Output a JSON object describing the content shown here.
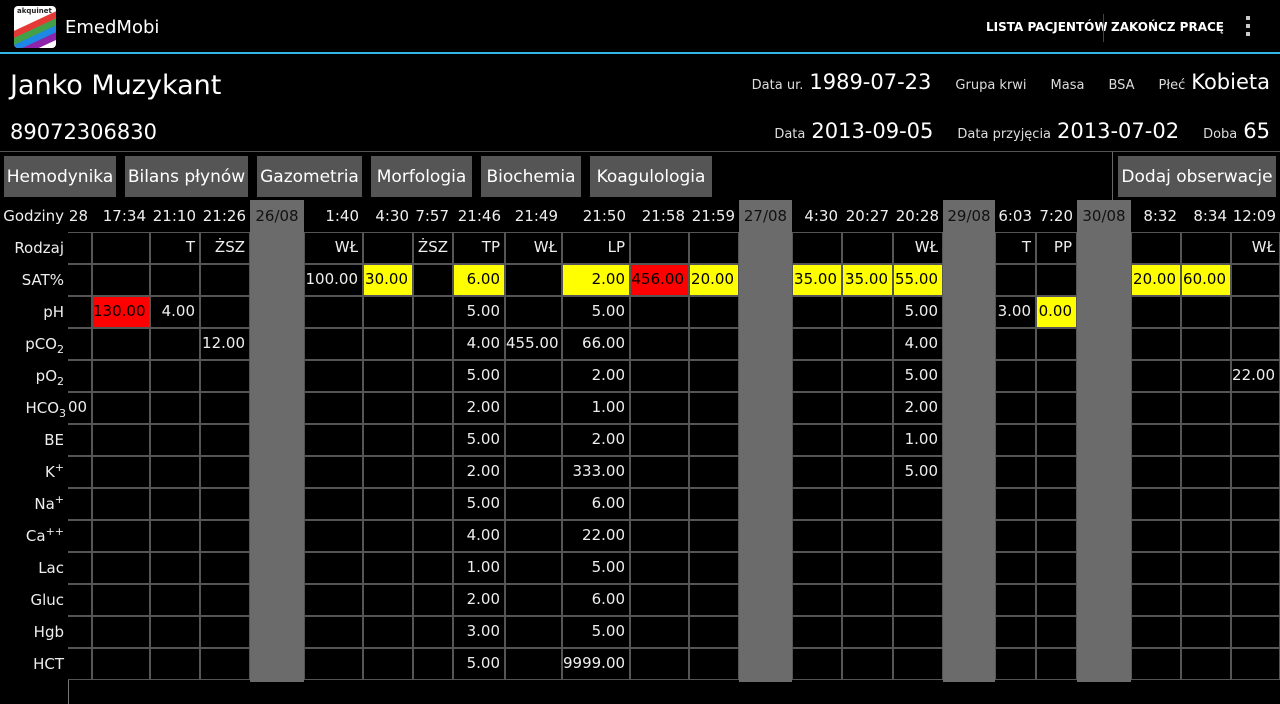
{
  "app": {
    "name": "EmedMobi",
    "logo_text": "akquinet"
  },
  "actions": {
    "patients": "LISTA PACJENTÓW",
    "finish": "ZAKOŃCZ PRACĘ"
  },
  "patient": {
    "name": "Janko Muzykant",
    "pesel": "89072306830",
    "dob_label": "Data ur.",
    "dob": "1989-07-23",
    "blood_label": "Grupa krwi",
    "mass_label": "Masa",
    "bsa_label": "BSA",
    "sex_label": "Płeć",
    "sex": "Kobieta",
    "date_label": "Data",
    "date": "2013-09-05",
    "admission_label": "Data przyjęcia",
    "admission": "2013-07-02",
    "day_label": "Doba",
    "day": "65"
  },
  "tabs": [
    "Hemodynika",
    "Bilans płynów",
    "Gazometria",
    "Morfologia",
    "Biochemia",
    "Koagulologia"
  ],
  "add_button": "Dodaj obserwacje",
  "row_labels": {
    "hours": "Godziny",
    "type": "Rodzaj",
    "sat": "SAT%",
    "ph": "pH",
    "pco2_base": "pCO",
    "pco2_sub": "2",
    "po2_base": "pO",
    "po2_sub": "2",
    "hco3_base": "HCO",
    "hco3_sub": "3",
    "be": "BE",
    "k_base": "K",
    "k_sup": "+",
    "na_base": "Na",
    "na_sup": "+",
    "ca_base": "Ca",
    "ca_sup": "++",
    "lac": "Lac",
    "gluc": "Gluc",
    "hgb": "Hgb",
    "hct": "HCT"
  },
  "table": {
    "columns": [
      {
        "kind": "data",
        "time": "28",
        "cells": [
          "",
          "",
          "",
          "",
          "",
          "00",
          "",
          "",
          "",
          "",
          "",
          "",
          "",
          ""
        ]
      },
      {
        "kind": "data",
        "time": "17:34",
        "cells": [
          "",
          "",
          "130.00",
          "",
          "",
          "",
          "",
          "",
          "",
          "",
          "",
          "",
          "",
          ""
        ]
      },
      {
        "kind": "data",
        "time": "21:10",
        "cells": [
          "T",
          "",
          "4.00",
          "",
          "",
          "",
          "",
          "",
          "",
          "",
          "",
          "",
          "",
          ""
        ]
      },
      {
        "kind": "data",
        "time": "21:26",
        "cells": [
          "ŻSZ",
          "",
          "",
          "12.00",
          "",
          "",
          "",
          "",
          "",
          "",
          "",
          "",
          "",
          ""
        ]
      },
      {
        "kind": "date",
        "label": "26/08"
      },
      {
        "kind": "data",
        "time": "1:40",
        "cells": [
          "WŁ",
          "100.00",
          "",
          "",
          "",
          "",
          "",
          "",
          "",
          "",
          "",
          "",
          "",
          ""
        ]
      },
      {
        "kind": "data",
        "time": "4:30",
        "cells": [
          "",
          "30.00",
          "",
          "",
          "",
          "",
          "",
          "",
          "",
          "",
          "",
          "",
          "",
          ""
        ]
      },
      {
        "kind": "data",
        "time": "7:57",
        "cells": [
          "ŻSZ",
          "",
          "",
          "",
          "",
          "",
          "",
          "",
          "",
          "",
          "",
          "",
          "",
          ""
        ]
      },
      {
        "kind": "data",
        "time": "21:46",
        "cells": [
          "TP",
          "6.00",
          "5.00",
          "4.00",
          "5.00",
          "2.00",
          "5.00",
          "2.00",
          "5.00",
          "4.00",
          "1.00",
          "2.00",
          "3.00",
          "5.00"
        ]
      },
      {
        "kind": "data",
        "time": "21:49",
        "cells": [
          "WŁ",
          "",
          "",
          "455.00",
          "",
          "",
          "",
          "",
          "",
          "",
          "",
          "",
          "",
          ""
        ]
      },
      {
        "kind": "data",
        "time": "21:50",
        "cells": [
          "LP",
          "2.00",
          "5.00",
          "66.00",
          "2.00",
          "1.00",
          "2.00",
          "333.00",
          "6.00",
          "22.00",
          "5.00",
          "6.00",
          "5.00",
          "9999.00"
        ]
      },
      {
        "kind": "data",
        "time": "21:58",
        "cells": [
          "",
          "456.00",
          "",
          "",
          "",
          "",
          "",
          "",
          "",
          "",
          "",
          "",
          "",
          ""
        ]
      },
      {
        "kind": "data",
        "time": "21:59",
        "cells": [
          "",
          "20.00",
          "",
          "",
          "",
          "",
          "",
          "",
          "",
          "",
          "",
          "",
          "",
          ""
        ]
      },
      {
        "kind": "date",
        "label": "27/08"
      },
      {
        "kind": "data",
        "time": "4:30",
        "cells": [
          "",
          "35.00",
          "",
          "",
          "",
          "",
          "",
          "",
          "",
          "",
          "",
          "",
          "",
          ""
        ]
      },
      {
        "kind": "data",
        "time": "20:27",
        "cells": [
          "",
          "35.00",
          "",
          "",
          "",
          "",
          "",
          "",
          "",
          "",
          "",
          "",
          "",
          ""
        ]
      },
      {
        "kind": "data",
        "time": "20:28",
        "cells": [
          "WŁ",
          "55.00",
          "5.00",
          "4.00",
          "5.00",
          "2.00",
          "1.00",
          "5.00",
          "",
          "",
          "",
          "",
          "",
          ""
        ]
      },
      {
        "kind": "date",
        "label": "29/08"
      },
      {
        "kind": "data",
        "time": "6:03",
        "cells": [
          "T",
          "",
          "3.00",
          "",
          "",
          "",
          "",
          "",
          "",
          "",
          "",
          "",
          "",
          ""
        ]
      },
      {
        "kind": "data",
        "time": "7:20",
        "cells": [
          "PP",
          "",
          "0.00",
          "",
          "",
          "",
          "",
          "",
          "",
          "",
          "",
          "",
          "",
          ""
        ]
      },
      {
        "kind": "date",
        "label": "30/08"
      },
      {
        "kind": "data",
        "time": "8:32",
        "cells": [
          "",
          "20.00",
          "",
          "",
          "",
          "",
          "",
          "",
          "",
          "",
          "",
          "",
          "",
          ""
        ]
      },
      {
        "kind": "data",
        "time": "8:34",
        "cells": [
          "",
          "60.00",
          "",
          "",
          "",
          "",
          "",
          "",
          "",
          "",
          "",
          "",
          "",
          ""
        ]
      },
      {
        "kind": "data",
        "time": "12:09",
        "cells": [
          "WŁ",
          "",
          "",
          "",
          "22.00",
          "",
          "",
          "",
          "",
          "",
          "",
          "",
          "",
          ""
        ]
      }
    ],
    "highlights": {
      "yellow": [
        "6:1",
        "8:1",
        "10:1",
        "12:1",
        "14:1",
        "15:1",
        "16:1",
        "19:2",
        "21:1",
        "22:1"
      ],
      "red": [
        "1:2",
        "11:1"
      ]
    },
    "colors": {
      "yellow": "#ffff00",
      "red": "#ff0000",
      "date_column": "#6b6b6b",
      "accent": "#33b5e5"
    }
  }
}
